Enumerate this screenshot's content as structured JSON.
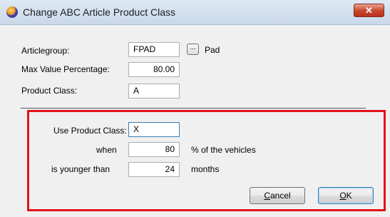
{
  "window": {
    "title": "Change ABC Article Product Class",
    "close_symbol": "✕"
  },
  "form": {
    "article_group": {
      "label": "Articlegroup:",
      "value": "FPAD",
      "browse_label": "...",
      "description": "Pad"
    },
    "max_value_percentage": {
      "label": "Max Value Percentage:",
      "value": "80.00"
    },
    "product_class": {
      "label": "Product Class:",
      "value": "A"
    }
  },
  "rule": {
    "use_product_class": {
      "label": "Use Product Class:",
      "value": "X"
    },
    "when": {
      "label": "when",
      "value": "80",
      "suffix": "% of the vehicles"
    },
    "younger_than": {
      "label": "is younger than",
      "value": "24",
      "suffix": "months"
    }
  },
  "buttons": {
    "cancel_first": "C",
    "cancel_rest": "ancel",
    "ok_first": "O",
    "ok_rest": "K"
  },
  "icons": {
    "app": "app-logo-icon",
    "close": "close-icon"
  },
  "colors": {
    "highlight_border": "#e3121a",
    "close_button": "#c8452b"
  }
}
